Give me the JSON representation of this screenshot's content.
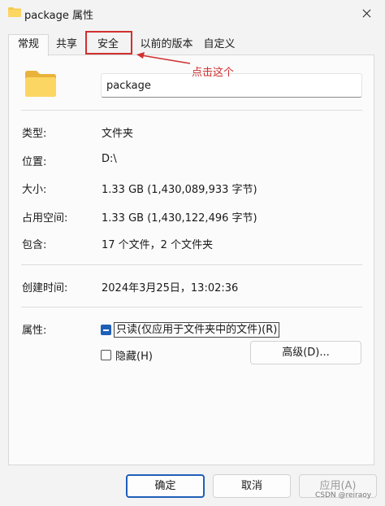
{
  "window": {
    "title": "package 属性"
  },
  "tabs": [
    {
      "label": "常规",
      "active": true
    },
    {
      "label": "共享",
      "active": false
    },
    {
      "label": "安全",
      "active": false
    },
    {
      "label": "以前的版本",
      "active": false
    },
    {
      "label": "自定义",
      "active": false
    }
  ],
  "annotation": {
    "text": "点击这个",
    "color": "#d0302f"
  },
  "general": {
    "name_value": "package",
    "fields": {
      "type_label": "类型:",
      "type_value": "文件夹",
      "location_label": "位置:",
      "location_value": "D:\\",
      "size_label": "大小:",
      "size_value": "1.33 GB (1,430,089,933 字节)",
      "size_on_disk_label": "占用空间:",
      "size_on_disk_value": "1.33 GB (1,430,122,496 字节)",
      "contains_label": "包含:",
      "contains_value": "17 个文件，2 个文件夹",
      "created_label": "创建时间:",
      "created_value": "2024年3月25日，13:02:36",
      "attributes_label": "属性:"
    },
    "readonly_label": "只读(仅应用于文件夹中的文件)(R)",
    "hidden_label": "隐藏(H)",
    "advanced_label": "高级(D)..."
  },
  "footer": {
    "ok_label": "确定",
    "cancel_label": "取消",
    "apply_label": "应用(A)"
  },
  "watermark": "CSDN @reiraoy",
  "colors": {
    "accent": "#1f5fb8",
    "annotation": "#d0302f",
    "folder": "#f8c94a"
  }
}
